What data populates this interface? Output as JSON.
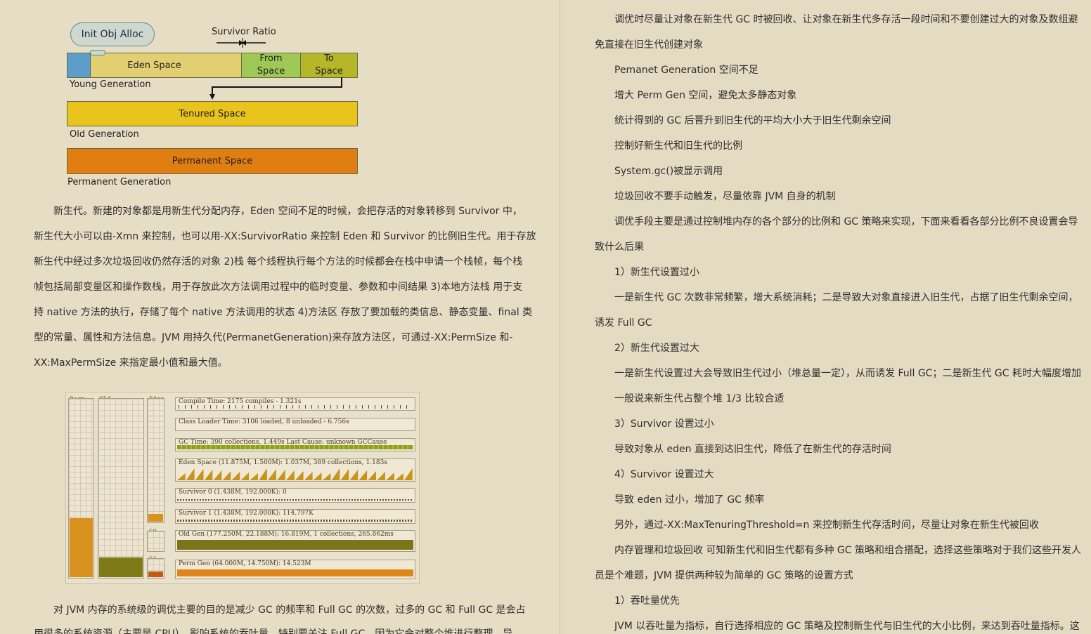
{
  "left_page": {
    "diagram": {
      "init_label": "Init Obj Alloc",
      "survivor_ratio_label": "Survivor Ratio",
      "eden_label": "Eden Space",
      "from_label_1": "From",
      "from_label_2": "Space",
      "to_label_1": "To",
      "to_label_2": "Space",
      "young_label": "Young Generation",
      "tenured_label": "Tenured Space",
      "old_label": "Old Generation",
      "permanent_label": "Permanent Space",
      "perm_gen_label": "Permanent Generation",
      "colors": {
        "eden": "#e2cf72",
        "survivor_from": "#9fc957",
        "survivor_to": "#b6b728",
        "tenured": "#e8c41c",
        "permanent": "#e07e12",
        "alloc_box": "#5c9ec9"
      }
    },
    "paragraph1": [
      "新生代。新建的对象都是用新生代分配内存，Eden 空间不足的时候，会把存活的对象转移到 Survivor 中，",
      "新生代大小可以由-Xmn 来控制，也可以用-XX:SurvivorRatio 来控制 Eden 和 Survivor 的比例旧生代。用于存放",
      "新生代中经过多次垃圾回收仍然存活的对象 2)栈 每个线程执行每个方法的时候都会在栈中申请一个栈帧，每个栈",
      "帧包括局部变量区和操作数栈，用于存放此次方法调用过程中的临时变量、参数和中间结果 3)本地方法栈 用于支",
      "持 native 方法的执行，存储了每个 native 方法调用的状态 4)方法区 存放了要加载的类信息、静态变量、final 类",
      "型的常量、属性和方法信息。JVM 用持久代(PermanetGeneration)来存放方法区，可通过-XX:PermSize 和-",
      "XX:MaxPermSize 来指定最小值和最大值。"
    ],
    "monitor": {
      "col_perm": "Perm",
      "col_old": "Old",
      "col_eden": "Eden",
      "col_s0": "S0",
      "col_s1": "S1",
      "strips": [
        "Compile Time: 2175 compiles - 1.321s",
        "Class Loader Time: 3106 loaded, 8 unloaded - 6.756s",
        "GC Time: 390 collections, 1.449s  Last Cause: unknown GCCause",
        "Eden Space (11.875M, 1.500M): 1.037M, 389 collections, 1.183s",
        "Survivor 0 (1.438M, 192.000K): 0",
        "Survivor 1 (1.438M, 192.000K): 114.797K",
        "Old Gen (177.250M, 22.188M): 16.819M, 1 collections, 265.862ms",
        "Perm Gen (64.000M, 14.750M): 14.523M"
      ],
      "levels": {
        "perm": 0.33,
        "old": 0.11,
        "eden": 0.06,
        "s1": 0.3
      }
    },
    "paragraph2": [
      "对 JVM 内存的系统级的调优主要的目的是减少 GC 的频率和 Full GC 的次数，过多的 GC 和 Full GC 是会占",
      "用很多的系统资源（主要是 CPU），影响系统的吞吐量。特别要关注 Full GC，因为它会对整个堆进行整理，导"
    ]
  },
  "right_page": {
    "lines": [
      "调优时尽量让对象在新生代 GC 时被回收、让对象在新生代多存活一段时间和不要创建过大的对象及数组避",
      "免直接在旧生代创建对象",
      "Pemanet Generation 空间不足",
      "增大 Perm Gen 空间，避免太多静态对象",
      "统计得到的 GC 后晋升到旧生代的平均大小大于旧生代剩余空间",
      "控制好新生代和旧生代的比例",
      "System.gc()被显示调用",
      "垃圾回收不要手动触发，尽量依靠 JVM 自身的机制",
      "调优手段主要是通过控制堆内存的各个部分的比例和 GC 策略来实现，下面来看看各部分比例不良设置会导",
      "致什么后果",
      "1）新生代设置过小",
      "一是新生代 GC 次数非常频繁，增大系统消耗；二是导致大对象直接进入旧生代，占据了旧生代剩余空间，",
      "诱发 Full GC",
      "2）新生代设置过大",
      "一是新生代设置过大会导致旧生代过小（堆总量一定），从而诱发 Full GC；二是新生代 GC 耗时大幅度增加",
      "一般说来新生代占整个堆 1/3 比较合适",
      "3）Survivor 设置过小",
      "导致对象从 eden 直接到达旧生代，降低了在新生代的存活时间",
      "4）Survivor 设置过大",
      "导致 eden 过小，增加了 GC 频率",
      "另外，通过-XX:MaxTenuringThreshold=n 来控制新生代存活时间，尽量让对象在新生代被回收",
      "内存管理和垃圾回收 可知新生代和旧生代都有多种 GC 策略和组合搭配，选择这些策略对于我们这些开发人",
      "员是个难题，JVM 提供两种较为简单的 GC 策略的设置方式",
      "1）吞吐量优先",
      "JVM 以吞吐量为指标，自行选择相应的 GC 策略及控制新生代与旧生代的大小比例，来达到吞吐量指标。这"
    ]
  }
}
